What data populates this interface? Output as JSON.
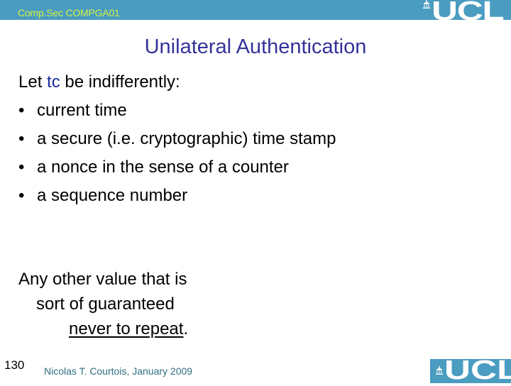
{
  "header": {
    "course_label": "Comp.Sec COMPGA01",
    "logo_text": "UCL",
    "bar_color": "#4a9cc0",
    "course_label_color": "#d4f04a"
  },
  "slide": {
    "title": "Unilateral Authentication",
    "title_color": "#333399",
    "intro_prefix": "Let ",
    "intro_highlight": "tc",
    "intro_suffix": " be indifferently:",
    "bullets": [
      "current time",
      "a secure (i.e. cryptographic) time stamp",
      "a nonce in the sense of a counter",
      "a sequence number"
    ],
    "bullet_glyph": "•",
    "note_line1": "Any other value that is",
    "note_line2": "sort of guaranteed",
    "note_line3_underlined": "never to repeat",
    "note_line3_end": "."
  },
  "footer": {
    "page_number": "130",
    "author": "Nicolas T. Courtois, January 2009",
    "logo_text": "UCL"
  }
}
